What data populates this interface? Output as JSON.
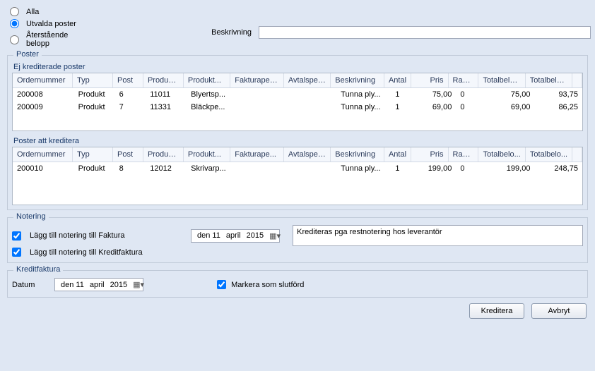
{
  "radios": {
    "alla": "Alla",
    "utvalda": "Utvalda poster",
    "aterstaende": "Återstående belopp",
    "selected": "utvalda"
  },
  "beskrivning": {
    "label": "Beskrivning",
    "value": ""
  },
  "poster": {
    "title": "Poster",
    "top_section": "Ej krediterade poster",
    "bottom_section": "Poster att kreditera",
    "headers": {
      "ordernummer": "Ordernummer",
      "typ": "Typ",
      "post": "Post",
      "produktgrupp": "Produkt...",
      "produktben": "Produkt...",
      "fakturaperiod": "Fakturaperiod",
      "fakturaperiod_short": "Fakturape...",
      "avtalsperiod": "Avtalsperiod",
      "beskrivning": "Beskrivning",
      "antal": "Antal",
      "pris": "Pris",
      "rabatt": "Rabatt",
      "totalbelop": "Totalbelop...",
      "totalbelo": "Totalbelo...",
      "totalbelop2": "Totalbelop..."
    },
    "top_rows": [
      {
        "on": "200008",
        "typ": "Produkt",
        "post": "6",
        "pg": "11011",
        "pb": "Blyertsp...",
        "fp": "",
        "ap": "",
        "be": "Tunna ply...",
        "an": "1",
        "pr": "75,00",
        "ra": "0",
        "tb": "75,00",
        "tb2": "93,75"
      },
      {
        "on": "200009",
        "typ": "Produkt",
        "post": "7",
        "pg": "11331",
        "pb": "Bläckpe...",
        "fp": "",
        "ap": "",
        "be": "Tunna ply...",
        "an": "1",
        "pr": "69,00",
        "ra": "0",
        "tb": "69,00",
        "tb2": "86,25"
      }
    ],
    "bottom_rows": [
      {
        "on": "200010",
        "typ": "Produkt",
        "post": "8",
        "pg": "12012",
        "pb": "Skrivarp...",
        "fp": "",
        "ap": "",
        "be": "Tunna ply...",
        "an": "1",
        "pr": "199,00",
        "ra": "0",
        "tb": "199,00",
        "tb2": "248,75"
      }
    ]
  },
  "notering": {
    "title": "Notering",
    "chk_faktura": "Lägg till notering till Faktura",
    "chk_kreditfaktura": "Lägg till notering till Kreditfaktura",
    "date": {
      "day": "den 11",
      "month": "april",
      "year": "2015"
    },
    "text": "Krediteras pga restnotering hos leverantör"
  },
  "kreditfaktura": {
    "title": "Kreditfaktura",
    "datum_label": "Datum",
    "date": {
      "day": "den 11",
      "month": "april",
      "year": "2015"
    },
    "markera": "Markera som slutförd"
  },
  "buttons": {
    "kreditera": "Kreditera",
    "avbryt": "Avbryt"
  }
}
